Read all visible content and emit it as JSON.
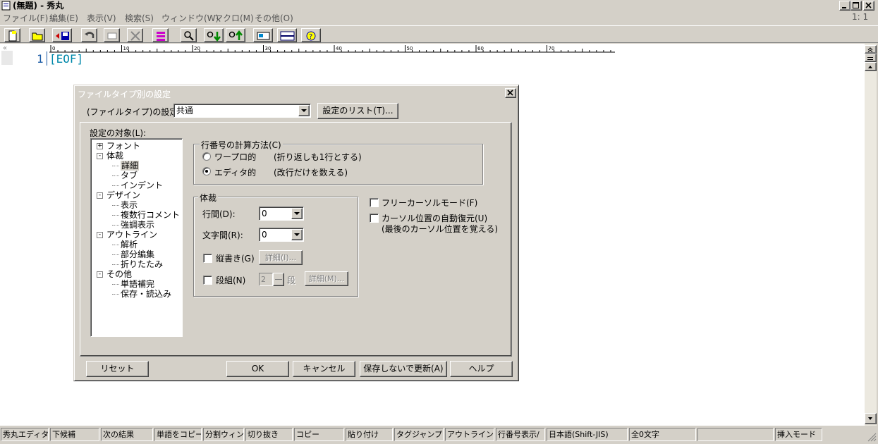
{
  "app": {
    "title": "(無題) - 秀丸",
    "position": "1: 1"
  },
  "menu": [
    "ファイル(F)",
    "編集(E)",
    "表示(V)",
    "検索(S)",
    "ウィンドウ(W)",
    "マクロ(M)",
    "その他(O)"
  ],
  "toolbar": {
    "buttons": [
      "new-file",
      "open-file",
      "save-file",
      "undo",
      "paste",
      "cut",
      "copy",
      "find",
      "find-down",
      "find-up",
      "clipboard",
      "window-split",
      "help"
    ]
  },
  "editor": {
    "line_number": "1",
    "eof_marker": "[EOF]",
    "ruler_labels": [
      "0",
      "10",
      "20",
      "30",
      "40",
      "50",
      "60",
      "70"
    ],
    "left_marker": "«"
  },
  "dialog": {
    "title": "ファイルタイプ別の設定",
    "filetype_label": "(ファイルタイプ)の設定(S)：",
    "filetype_value": "共通",
    "list_button": "設定のリスト(T)...",
    "target_label": "設定の対象(L):",
    "tree": [
      {
        "label": "フォント",
        "level": 0,
        "expander": "+"
      },
      {
        "label": "体裁",
        "level": 0,
        "expander": "-"
      },
      {
        "label": "詳細",
        "level": 1,
        "selected": true
      },
      {
        "label": "タブ",
        "level": 1
      },
      {
        "label": "インデント",
        "level": 1
      },
      {
        "label": "デザイン",
        "level": 0,
        "expander": "-"
      },
      {
        "label": "表示",
        "level": 1
      },
      {
        "label": "複数行コメント",
        "level": 1
      },
      {
        "label": "強調表示",
        "level": 1
      },
      {
        "label": "アウトライン",
        "level": 0,
        "expander": "-"
      },
      {
        "label": "解析",
        "level": 1
      },
      {
        "label": "部分編集",
        "level": 1
      },
      {
        "label": "折りたたみ",
        "level": 1
      },
      {
        "label": "その他",
        "level": 0,
        "expander": "-"
      },
      {
        "label": "単語補完",
        "level": 1
      },
      {
        "label": "保存・読込み",
        "level": 1
      }
    ],
    "line_calc": {
      "caption": "行番号の計算方法(C)",
      "options": [
        {
          "label": "ワープロ的",
          "desc": "(折り返しも1行とする)",
          "selected": false
        },
        {
          "label": "エディタ的",
          "desc": "(改行だけを数える)",
          "selected": true
        }
      ]
    },
    "layout": {
      "caption": "体裁",
      "line_spacing_label": "行間(D):",
      "line_spacing_value": "0",
      "char_spacing_label": "文字間(R):",
      "char_spacing_value": "0",
      "vertical_label": "縦書き(G)",
      "vertical_detail": "詳細(I)...",
      "columns_label": "段組(N)",
      "columns_value": "2",
      "columns_unit": "段",
      "columns_detail": "詳細(M)..."
    },
    "free_cursor": "フリーカーソルモード(F)",
    "cursor_restore": "カーソル位置の自動復元(U)",
    "cursor_restore_note": "(最後のカーソル位置を覚える)",
    "buttons": {
      "reset": "リセット",
      "ok": "OK",
      "cancel": "キャンセル",
      "update": "保存しないで更新(A)",
      "help": "ヘルプ"
    }
  },
  "statusbar": [
    "秀丸エディタヘルプ",
    "下候補",
    "次の結果",
    "単語をコピー",
    "分割ウィンドウ切",
    "切り抜き",
    "コピー",
    "貼り付け",
    "タグジャンプ",
    "アウトライン解析",
    "行番号表示/",
    "日本語(Shift-JIS)",
    "全0文字",
    "",
    "挿入モード"
  ]
}
